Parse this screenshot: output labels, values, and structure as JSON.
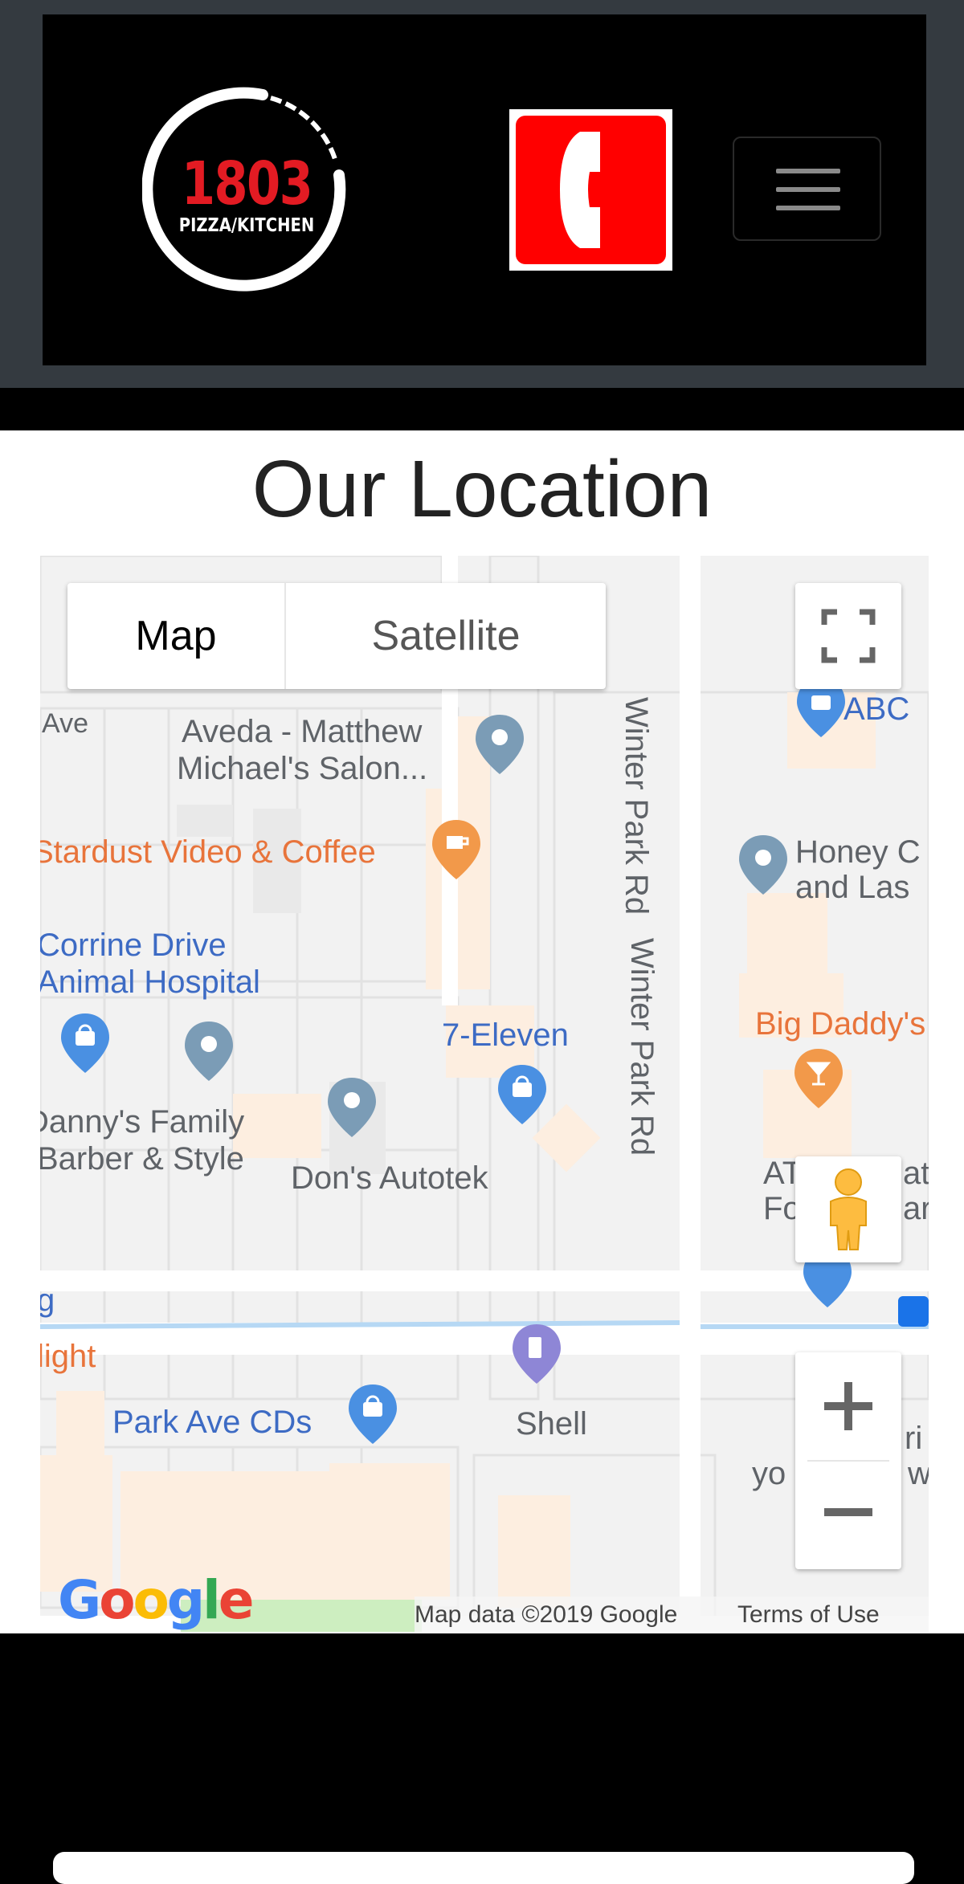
{
  "header": {
    "logo": {
      "number": "1803",
      "subtitle": "PIZZA/KITCHEN"
    },
    "phone_icon": "phone-icon",
    "menu_icon": "hamburger-menu-icon"
  },
  "page": {
    "title": "Our Location"
  },
  "map": {
    "type_control": {
      "map_label": "Map",
      "satellite_label": "Satellite"
    },
    "labels": {
      "ave": "Ave",
      "aveda1": "Aveda - Matthew",
      "aveda2": "Michael's Salon...",
      "winter1": "Winter Park Rd",
      "winter2": "Winter Park Rd",
      "abc": "ABC",
      "honey1": "Honey C",
      "honey2": "and Las",
      "stardust": "Stardust Video & Coffee",
      "corrine1": "Corrine Drive",
      "corrine2": "Animal Hospital",
      "seven": "7-Eleven",
      "bigdaddy": "Big Daddy's",
      "danny1": "Danny's Family",
      "danny2": "Barber & Style",
      "dons": "Don's Autotek",
      "at1": "AT",
      "at2": "Fo",
      "at3": "at",
      "at4": "ar",
      "g": "g",
      "light": "light",
      "parkave": "Park Ave CDs",
      "shell": "Shell",
      "right1": "ri",
      "right2": "yo",
      "right3": "w",
      "atm": "ATM"
    },
    "google_logo": "Google",
    "attribution": "Map data ©2019 Google",
    "terms": "Terms of Use"
  },
  "colors": {
    "header_bg": "#343a40",
    "brand_red": "#e31b23",
    "phone_red": "#ff0000"
  }
}
